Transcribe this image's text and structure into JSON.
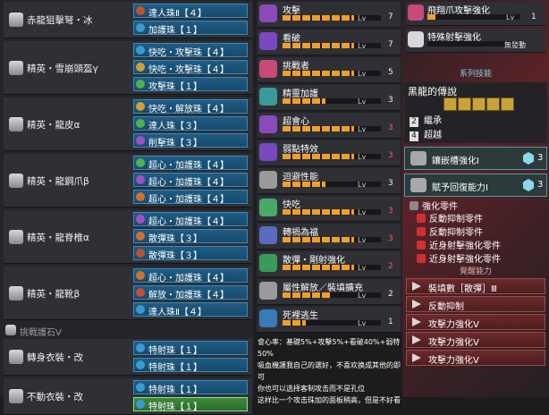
{
  "left": {
    "rows": [
      {
        "name": "赤龍狙擊弩・冰",
        "decos": [
          "達人珠Ⅱ【４】",
          "加護珠【１】"
        ]
      },
      {
        "name": "精英・雪崩頭盔γ",
        "decos": [
          "快吃・攻擊珠【４】",
          "快吃・攻擊珠【４】",
          "攻擊珠【１】"
        ]
      },
      {
        "name": "精英・龍皮α",
        "decos": [
          "快吃・解放珠【４】",
          "達人珠【３】",
          "削擊珠【３】"
        ]
      },
      {
        "name": "精英・龍鋼爪β",
        "decos": [
          "超心・加護珠【４】",
          "超心・加護珠【４】",
          "超心・加護珠【４】"
        ]
      },
      {
        "name": "精英・龍脊椎α",
        "decos": [
          "超心・加護珠【４】",
          "散彈珠【３】",
          "散彈珠【３】"
        ]
      },
      {
        "name": "精英・龍靴β",
        "decos": [
          "超心・加護珠【４】",
          "解放・加護珠【４】",
          "達人珠Ⅱ【４】"
        ]
      }
    ],
    "charm": "挑戰護石Ⅴ",
    "layered": [
      {
        "name": "轉身衣裝・改",
        "decos": [
          "特射珠【１】",
          "特射珠【１】"
        ]
      },
      {
        "name": "不動衣裝・改",
        "decos": [
          "特射珠【１】",
          "特射珠【１】"
        ]
      }
    ]
  },
  "skills": [
    {
      "name": "攻擊",
      "lv": "7",
      "fill": 1.0,
      "color": "#8a4ab8",
      "red": false
    },
    {
      "name": "看破",
      "lv": "7",
      "fill": 1.0,
      "color": "#7a48c0",
      "red": false
    },
    {
      "name": "挑戰者",
      "lv": "5",
      "fill": 1.0,
      "color": "#c84a7a",
      "red": false
    },
    {
      "name": "精靈加護",
      "lv": "3",
      "fill": 0.6,
      "color": "#3a9a9a",
      "red": false
    },
    {
      "name": "超會心",
      "lv": "3",
      "fill": 1.0,
      "color": "#8a4ab8",
      "red": true
    },
    {
      "name": "弱點特效",
      "lv": "3",
      "fill": 1.0,
      "color": "#7a48c0",
      "red": true
    },
    {
      "name": "迴避性能",
      "lv": "3",
      "fill": 0.6,
      "color": "#9a9a9a",
      "red": false
    },
    {
      "name": "快吃",
      "lv": "3",
      "fill": 1.0,
      "color": "#4aa86a",
      "red": true
    },
    {
      "name": "轉禍為福",
      "lv": "3",
      "fill": 1.0,
      "color": "#5a6ac0",
      "red": true
    },
    {
      "name": "散彈・剛射強化",
      "lv": "2",
      "fill": 1.0,
      "color": "#3a9a5a",
      "red": true
    },
    {
      "name": "屬性解放／裝填擴充",
      "lv": "2",
      "fill": 0.66,
      "color": "#9a9a9a",
      "red": false
    },
    {
      "name": "死裡逃生",
      "lv": "1",
      "fill": 0.33,
      "color": "#3a7ab8",
      "red": false
    }
  ],
  "lv_prefix": "Lv",
  "right_skills": [
    {
      "name": "飛翔爪攻擊強化",
      "lv": "1",
      "max": false,
      "color": "#c84a7a"
    },
    {
      "name": "特殊射擊強化",
      "lv": "",
      "max": true,
      "max_text": "無發動",
      "color": "#d8d8d8"
    }
  ],
  "set_header": "系列技能",
  "set_box": {
    "title": "黑龍的傳說",
    "bonuses": [
      {
        "n": "2",
        "label": "繼承"
      },
      {
        "n": "4",
        "label": "超越"
      }
    ]
  },
  "wide_items": [
    {
      "name": "鑲嵌槽強化Ⅰ",
      "num": "3"
    },
    {
      "name": "賦予回復能力Ⅰ",
      "num": "3"
    }
  ],
  "parts_header": "強化零件",
  "parts": [
    "反動抑制零件",
    "反動抑制零件",
    "近身射擊強化零件",
    "近身射擊強化零件"
  ],
  "aug_header": "覺醒能力",
  "augments": [
    "裝填數［散彈］Ⅲ",
    "反動抑制",
    "攻擊力強化Ⅴ",
    "攻擊力強化Ⅴ",
    "攻擊力強化Ⅴ"
  ],
  "note": {
    "line1": "會心率：基礎5%+攻擊5%+看破40%+弱特50%",
    "line2": "吸血機護我自己的選好，不喜欢换成其他的即可",
    "line3": "你也可以选择客制攻击而不是孔位",
    "line4": "这样比一个攻击珠加的面板稍高，但是不好看"
  }
}
